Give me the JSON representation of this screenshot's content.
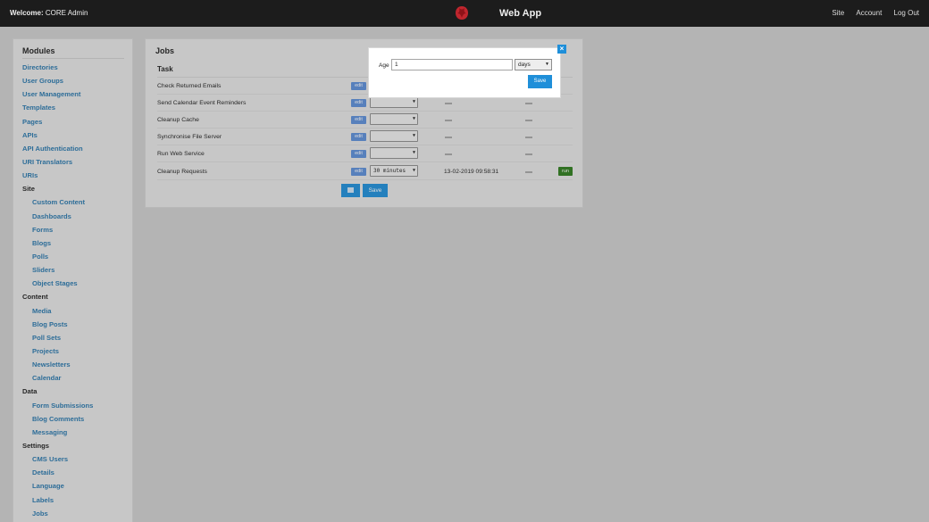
{
  "header": {
    "welcome_label": "Welcome:",
    "welcome_user": "CORE Admin",
    "app_title": "Web App",
    "nav": [
      "Site",
      "Account",
      "Log Out"
    ],
    "logo_color": "#c0262e"
  },
  "sidebar": {
    "title": "Modules",
    "items": [
      {
        "label": "Directories",
        "kind": "link"
      },
      {
        "label": "User Groups",
        "kind": "link"
      },
      {
        "label": "User Management",
        "kind": "link"
      },
      {
        "label": "Templates",
        "kind": "link"
      },
      {
        "label": "Pages",
        "kind": "link"
      },
      {
        "label": "APIs",
        "kind": "link"
      },
      {
        "label": "API Authentication",
        "kind": "link"
      },
      {
        "label": "URI Translators",
        "kind": "link"
      },
      {
        "label": "URIs",
        "kind": "link"
      },
      {
        "label": "Site",
        "kind": "head"
      },
      {
        "label": "Custom Content",
        "kind": "sub"
      },
      {
        "label": "Dashboards",
        "kind": "sub"
      },
      {
        "label": "Forms",
        "kind": "sub"
      },
      {
        "label": "Blogs",
        "kind": "sub"
      },
      {
        "label": "Polls",
        "kind": "sub"
      },
      {
        "label": "Sliders",
        "kind": "sub"
      },
      {
        "label": "Object Stages",
        "kind": "sub"
      },
      {
        "label": "Content",
        "kind": "head"
      },
      {
        "label": "Media",
        "kind": "sub"
      },
      {
        "label": "Blog Posts",
        "kind": "sub"
      },
      {
        "label": "Poll Sets",
        "kind": "sub"
      },
      {
        "label": "Projects",
        "kind": "sub"
      },
      {
        "label": "Newsletters",
        "kind": "sub"
      },
      {
        "label": "Calendar",
        "kind": "sub"
      },
      {
        "label": "Data",
        "kind": "head"
      },
      {
        "label": "Form Submissions",
        "kind": "sub"
      },
      {
        "label": "Blog Comments",
        "kind": "sub"
      },
      {
        "label": "Messaging",
        "kind": "sub"
      },
      {
        "label": "Settings",
        "kind": "head"
      },
      {
        "label": "CMS Users",
        "kind": "sub"
      },
      {
        "label": "Details",
        "kind": "sub"
      },
      {
        "label": "Language",
        "kind": "sub"
      },
      {
        "label": "Labels",
        "kind": "sub"
      },
      {
        "label": "Jobs",
        "kind": "sub"
      }
    ]
  },
  "jobs": {
    "title": "Jobs",
    "column_task": "Task",
    "edit_label": "edit",
    "run_label": "run",
    "save_label": "Save",
    "rows": [
      {
        "task": "Check Returned Emails",
        "interval": "",
        "last_run": "",
        "has_run": false
      },
      {
        "task": "Send Calendar Event Reminders",
        "interval": "",
        "last_run": "",
        "has_run": false
      },
      {
        "task": "Cleanup Cache",
        "interval": "",
        "last_run": "",
        "has_run": false
      },
      {
        "task": "Synchronise File Server",
        "interval": "",
        "last_run": "",
        "has_run": false
      },
      {
        "task": "Run Web Service",
        "interval": "",
        "last_run": "",
        "has_run": false
      },
      {
        "task": "Cleanup Requests",
        "interval": "30 minutes",
        "last_run": "13-02-2019 09:58:31",
        "has_run": true
      }
    ]
  },
  "modal": {
    "age_label": "Age",
    "age_value": "1",
    "unit_value": "days",
    "save_label": "Save",
    "close_glyph": "×"
  },
  "colors": {
    "accent": "#1f8fd9",
    "link": "#2a78ad",
    "run": "#2f7d1e",
    "edit": "#5d8fd8"
  }
}
